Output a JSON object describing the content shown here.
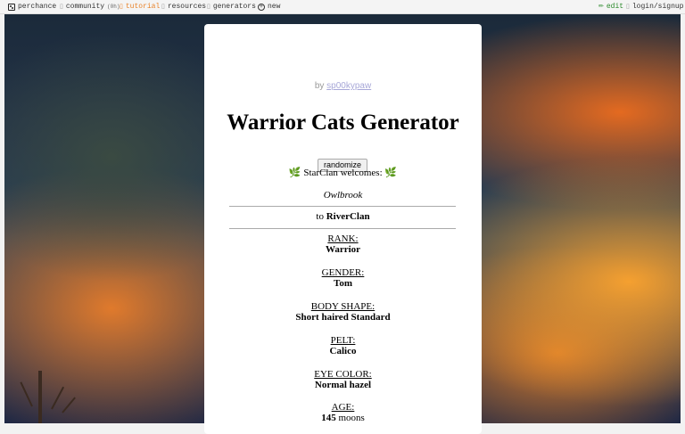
{
  "nav": {
    "logo_icon": "die-icon",
    "perchance": "perchance",
    "community": "community",
    "community_badge": "(0h)",
    "tutorial": "tutorial",
    "resources": "resources",
    "generators": "generators",
    "new": "new",
    "edit": "edit",
    "login": "login/signup",
    "accent_color": "#e8832a",
    "edit_color": "#2e8b2e"
  },
  "card": {
    "by_prefix": "by",
    "author": "sp00kypaw",
    "title": "Warrior Cats Generator",
    "randomize_label": "randomize",
    "welcome_symbol": "🌿",
    "welcome_text": "StarClan welcomes:",
    "cat_name": "Owlbrook",
    "to_prefix": "to",
    "clan": "RiverClan",
    "fields": [
      {
        "label": "RANK:",
        "value": "Warrior"
      },
      {
        "label": "GENDER:",
        "value": "Tom"
      },
      {
        "label": "BODY SHAPE:",
        "value": "Short haired Standard"
      },
      {
        "label": "PELT:",
        "value": "Calico"
      },
      {
        "label": "EYE COLOR:",
        "value": "Normal hazel"
      },
      {
        "label": "AGE:",
        "value": "145",
        "unit": "moons"
      }
    ]
  }
}
